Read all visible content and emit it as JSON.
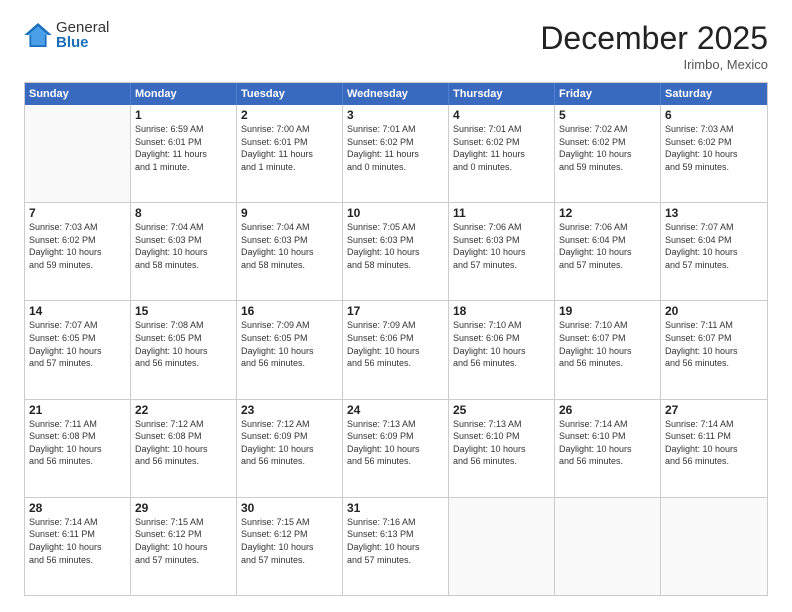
{
  "logo": {
    "general": "General",
    "blue": "Blue"
  },
  "title": "December 2025",
  "subtitle": "Irimbo, Mexico",
  "header_days": [
    "Sunday",
    "Monday",
    "Tuesday",
    "Wednesday",
    "Thursday",
    "Friday",
    "Saturday"
  ],
  "rows": [
    [
      {
        "day": "",
        "info": ""
      },
      {
        "day": "1",
        "info": "Sunrise: 6:59 AM\nSunset: 6:01 PM\nDaylight: 11 hours\nand 1 minute."
      },
      {
        "day": "2",
        "info": "Sunrise: 7:00 AM\nSunset: 6:01 PM\nDaylight: 11 hours\nand 1 minute."
      },
      {
        "day": "3",
        "info": "Sunrise: 7:01 AM\nSunset: 6:02 PM\nDaylight: 11 hours\nand 0 minutes."
      },
      {
        "day": "4",
        "info": "Sunrise: 7:01 AM\nSunset: 6:02 PM\nDaylight: 11 hours\nand 0 minutes."
      },
      {
        "day": "5",
        "info": "Sunrise: 7:02 AM\nSunset: 6:02 PM\nDaylight: 10 hours\nand 59 minutes."
      },
      {
        "day": "6",
        "info": "Sunrise: 7:03 AM\nSunset: 6:02 PM\nDaylight: 10 hours\nand 59 minutes."
      }
    ],
    [
      {
        "day": "7",
        "info": "Sunrise: 7:03 AM\nSunset: 6:02 PM\nDaylight: 10 hours\nand 59 minutes."
      },
      {
        "day": "8",
        "info": "Sunrise: 7:04 AM\nSunset: 6:03 PM\nDaylight: 10 hours\nand 58 minutes."
      },
      {
        "day": "9",
        "info": "Sunrise: 7:04 AM\nSunset: 6:03 PM\nDaylight: 10 hours\nand 58 minutes."
      },
      {
        "day": "10",
        "info": "Sunrise: 7:05 AM\nSunset: 6:03 PM\nDaylight: 10 hours\nand 58 minutes."
      },
      {
        "day": "11",
        "info": "Sunrise: 7:06 AM\nSunset: 6:03 PM\nDaylight: 10 hours\nand 57 minutes."
      },
      {
        "day": "12",
        "info": "Sunrise: 7:06 AM\nSunset: 6:04 PM\nDaylight: 10 hours\nand 57 minutes."
      },
      {
        "day": "13",
        "info": "Sunrise: 7:07 AM\nSunset: 6:04 PM\nDaylight: 10 hours\nand 57 minutes."
      }
    ],
    [
      {
        "day": "14",
        "info": "Sunrise: 7:07 AM\nSunset: 6:05 PM\nDaylight: 10 hours\nand 57 minutes."
      },
      {
        "day": "15",
        "info": "Sunrise: 7:08 AM\nSunset: 6:05 PM\nDaylight: 10 hours\nand 56 minutes."
      },
      {
        "day": "16",
        "info": "Sunrise: 7:09 AM\nSunset: 6:05 PM\nDaylight: 10 hours\nand 56 minutes."
      },
      {
        "day": "17",
        "info": "Sunrise: 7:09 AM\nSunset: 6:06 PM\nDaylight: 10 hours\nand 56 minutes."
      },
      {
        "day": "18",
        "info": "Sunrise: 7:10 AM\nSunset: 6:06 PM\nDaylight: 10 hours\nand 56 minutes."
      },
      {
        "day": "19",
        "info": "Sunrise: 7:10 AM\nSunset: 6:07 PM\nDaylight: 10 hours\nand 56 minutes."
      },
      {
        "day": "20",
        "info": "Sunrise: 7:11 AM\nSunset: 6:07 PM\nDaylight: 10 hours\nand 56 minutes."
      }
    ],
    [
      {
        "day": "21",
        "info": "Sunrise: 7:11 AM\nSunset: 6:08 PM\nDaylight: 10 hours\nand 56 minutes."
      },
      {
        "day": "22",
        "info": "Sunrise: 7:12 AM\nSunset: 6:08 PM\nDaylight: 10 hours\nand 56 minutes."
      },
      {
        "day": "23",
        "info": "Sunrise: 7:12 AM\nSunset: 6:09 PM\nDaylight: 10 hours\nand 56 minutes."
      },
      {
        "day": "24",
        "info": "Sunrise: 7:13 AM\nSunset: 6:09 PM\nDaylight: 10 hours\nand 56 minutes."
      },
      {
        "day": "25",
        "info": "Sunrise: 7:13 AM\nSunset: 6:10 PM\nDaylight: 10 hours\nand 56 minutes."
      },
      {
        "day": "26",
        "info": "Sunrise: 7:14 AM\nSunset: 6:10 PM\nDaylight: 10 hours\nand 56 minutes."
      },
      {
        "day": "27",
        "info": "Sunrise: 7:14 AM\nSunset: 6:11 PM\nDaylight: 10 hours\nand 56 minutes."
      }
    ],
    [
      {
        "day": "28",
        "info": "Sunrise: 7:14 AM\nSunset: 6:11 PM\nDaylight: 10 hours\nand 56 minutes."
      },
      {
        "day": "29",
        "info": "Sunrise: 7:15 AM\nSunset: 6:12 PM\nDaylight: 10 hours\nand 57 minutes."
      },
      {
        "day": "30",
        "info": "Sunrise: 7:15 AM\nSunset: 6:12 PM\nDaylight: 10 hours\nand 57 minutes."
      },
      {
        "day": "31",
        "info": "Sunrise: 7:16 AM\nSunset: 6:13 PM\nDaylight: 10 hours\nand 57 minutes."
      },
      {
        "day": "",
        "info": ""
      },
      {
        "day": "",
        "info": ""
      },
      {
        "day": "",
        "info": ""
      }
    ]
  ]
}
